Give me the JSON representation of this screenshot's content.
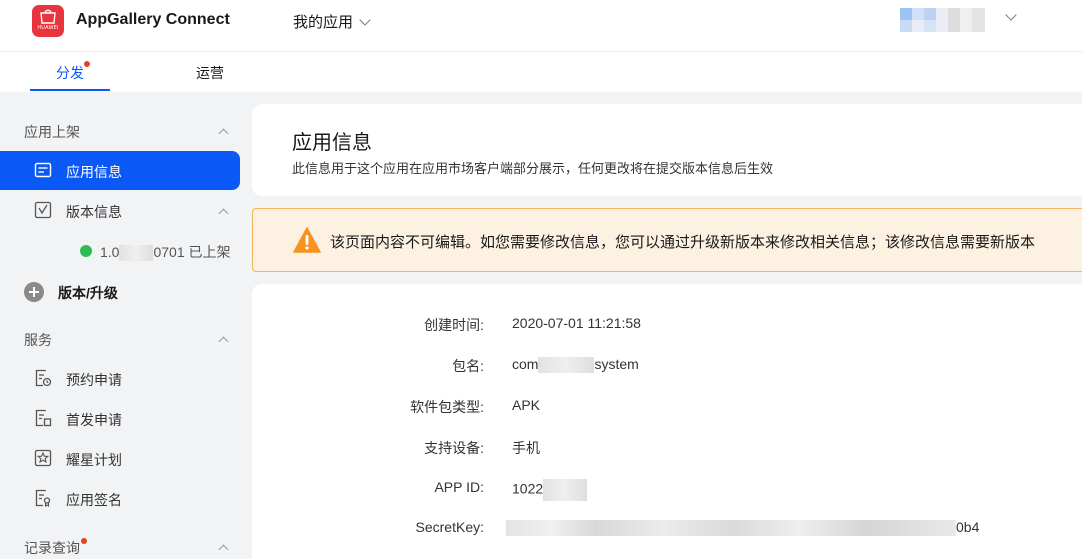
{
  "topbar": {
    "logo_text": "HUAWEI",
    "brand": "AppGallery Connect",
    "app_switch": "我的应用"
  },
  "tabs": [
    {
      "label": "分发",
      "active": true,
      "has_dot": true
    },
    {
      "label": "运营",
      "active": false
    }
  ],
  "sidebar": {
    "group1_title": "应用上架",
    "items1": [
      {
        "label": "应用信息",
        "icon": "app-info-icon",
        "active": true
      },
      {
        "label": "版本信息",
        "icon": "version-info-icon",
        "active": false
      }
    ],
    "version_prefix": "1.0",
    "version_suffix": "0701 已上架",
    "add_version": "版本/升级",
    "group2_title": "服务",
    "items2": [
      {
        "label": "预约申请",
        "icon": "reservation-icon"
      },
      {
        "label": "首发申请",
        "icon": "first-launch-icon"
      },
      {
        "label": "耀星计划",
        "icon": "star-plan-icon"
      },
      {
        "label": "应用签名",
        "icon": "app-signature-icon"
      }
    ],
    "group3_title": "记录查询"
  },
  "header": {
    "title": "应用信息",
    "subtitle": "此信息用于这个应用在应用市场客户端部分展示，任何更改将在提交版本信息后生效"
  },
  "alert": {
    "text": "该页面内容不可编辑。如您需要修改信息，您可以通过升级新版本来修改相关信息；该修改信息需要新版本"
  },
  "info": {
    "created_label": "创建时间:",
    "created_value": "2020-07-01 11:21:58",
    "package_label": "包名:",
    "package_prefix": "com",
    "package_suffix": "system",
    "pkgtype_label": "软件包类型:",
    "pkgtype_value": "APK",
    "device_label": "支持设备:",
    "device_value": "手机",
    "appid_label": "APP ID:",
    "appid_value": "1022",
    "secret_label": "SecretKey:",
    "secret_suffix": "0b4"
  },
  "colors": {
    "accent": "#0a59f7",
    "alert_bg": "#fdf1e2",
    "alert_border": "#f4b45c",
    "status_green": "#2fbb4f",
    "brand_red": "#e8343c"
  }
}
